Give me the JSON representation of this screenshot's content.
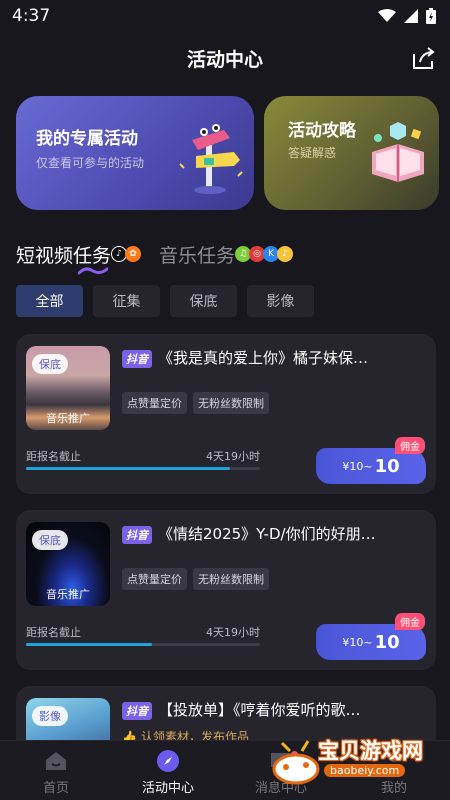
{
  "status_bar": {
    "time": "4:37"
  },
  "header": {
    "title": "活动中心"
  },
  "banners": [
    {
      "title": "我的专属活动",
      "subtitle": "仅查看可参与的活动"
    },
    {
      "title": "活动攻略",
      "subtitle": "答疑解惑"
    }
  ],
  "main_tabs": [
    {
      "label": "短视频任务",
      "active": true
    },
    {
      "label": "音乐任务",
      "active": false
    }
  ],
  "filters": [
    "全部",
    "征集",
    "保底",
    "影像"
  ],
  "cards": [
    {
      "cover_tag": "保底",
      "cover_caption": "音乐推广",
      "platform": "抖音",
      "title": "《我是真的爱上你》橘子妹保…",
      "tags": [
        "点赞量定价",
        "无粉丝数限制"
      ],
      "deadline_label": "距报名截止",
      "deadline_time": "4天19小时",
      "progress": 0.87,
      "price_range": "¥10~",
      "price_big": "10",
      "commission": "佣金"
    },
    {
      "cover_tag": "保底",
      "cover_caption": "音乐推广",
      "platform": "抖音",
      "title": "《情结2025》Y-D/你们的好朋…",
      "tags": [
        "点赞量定价",
        "无粉丝数限制"
      ],
      "deadline_label": "距报名截止",
      "deadline_time": "4天19小时",
      "progress": 0.54,
      "price_range": "¥10~",
      "price_big": "10",
      "commission": "佣金"
    },
    {
      "cover_tag": "影像",
      "platform": "抖音",
      "title": "【投放单】《哼着你爱听的歌…",
      "subtitle": "认领素材，发布作品"
    }
  ],
  "bottom_nav": [
    {
      "label": "首页",
      "icon": "home-icon"
    },
    {
      "label": "活动中心",
      "icon": "compass-icon"
    },
    {
      "label": "消息中心",
      "icon": "message-icon"
    },
    {
      "label": "我的",
      "icon": "profile-icon"
    }
  ],
  "watermark": {
    "title": "宝贝游戏网",
    "url": "baobeiy.com"
  },
  "colors": {
    "accent": "#5a63e8",
    "progress": "#1fa4d8",
    "commission": "#ff4f76"
  }
}
